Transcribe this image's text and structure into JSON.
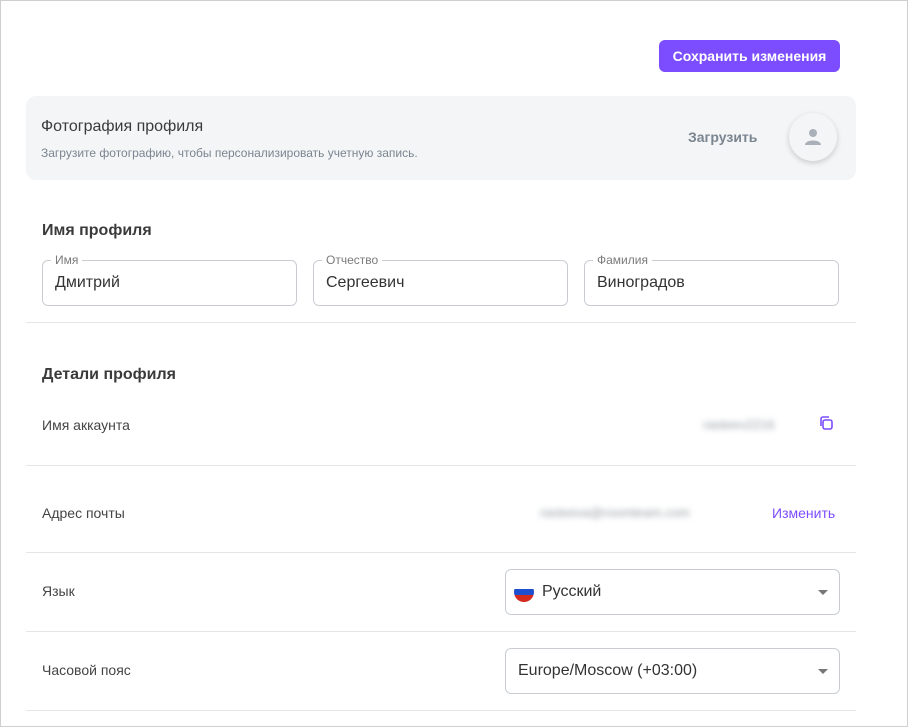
{
  "toolbar": {
    "save_label": "Сохранить изменения"
  },
  "photo": {
    "title": "Фотография профиля",
    "subtitle": "Загрузите фотографию, чтобы персонализировать учетную запись.",
    "upload_label": "Загрузить",
    "avatar_icon": "user-icon"
  },
  "profile_name": {
    "title": "Имя профиля",
    "fields": [
      {
        "label": "Имя",
        "value": "Дмитрий"
      },
      {
        "label": "Отчество",
        "value": "Сергеевич"
      },
      {
        "label": "Фамилия",
        "value": "Виноградов"
      }
    ]
  },
  "profile_details": {
    "title": "Детали профиля",
    "account": {
      "label": "Имя аккаунта",
      "value": "rasteev2216",
      "copy_icon": "copy-icon"
    },
    "email": {
      "label": "Адрес почты",
      "value": "rasteeva@roomteam.com",
      "change_label": "Изменить"
    },
    "language": {
      "label": "Язык",
      "value": "Русский",
      "flag_icon": "russia-flag-icon"
    },
    "timezone": {
      "label": "Часовой пояс",
      "value": "Europe/Moscow (+03:00)"
    }
  },
  "colors": {
    "accent": "#7c4dff",
    "card_bg": "#f4f5f7",
    "border": "#c9cdd2"
  }
}
